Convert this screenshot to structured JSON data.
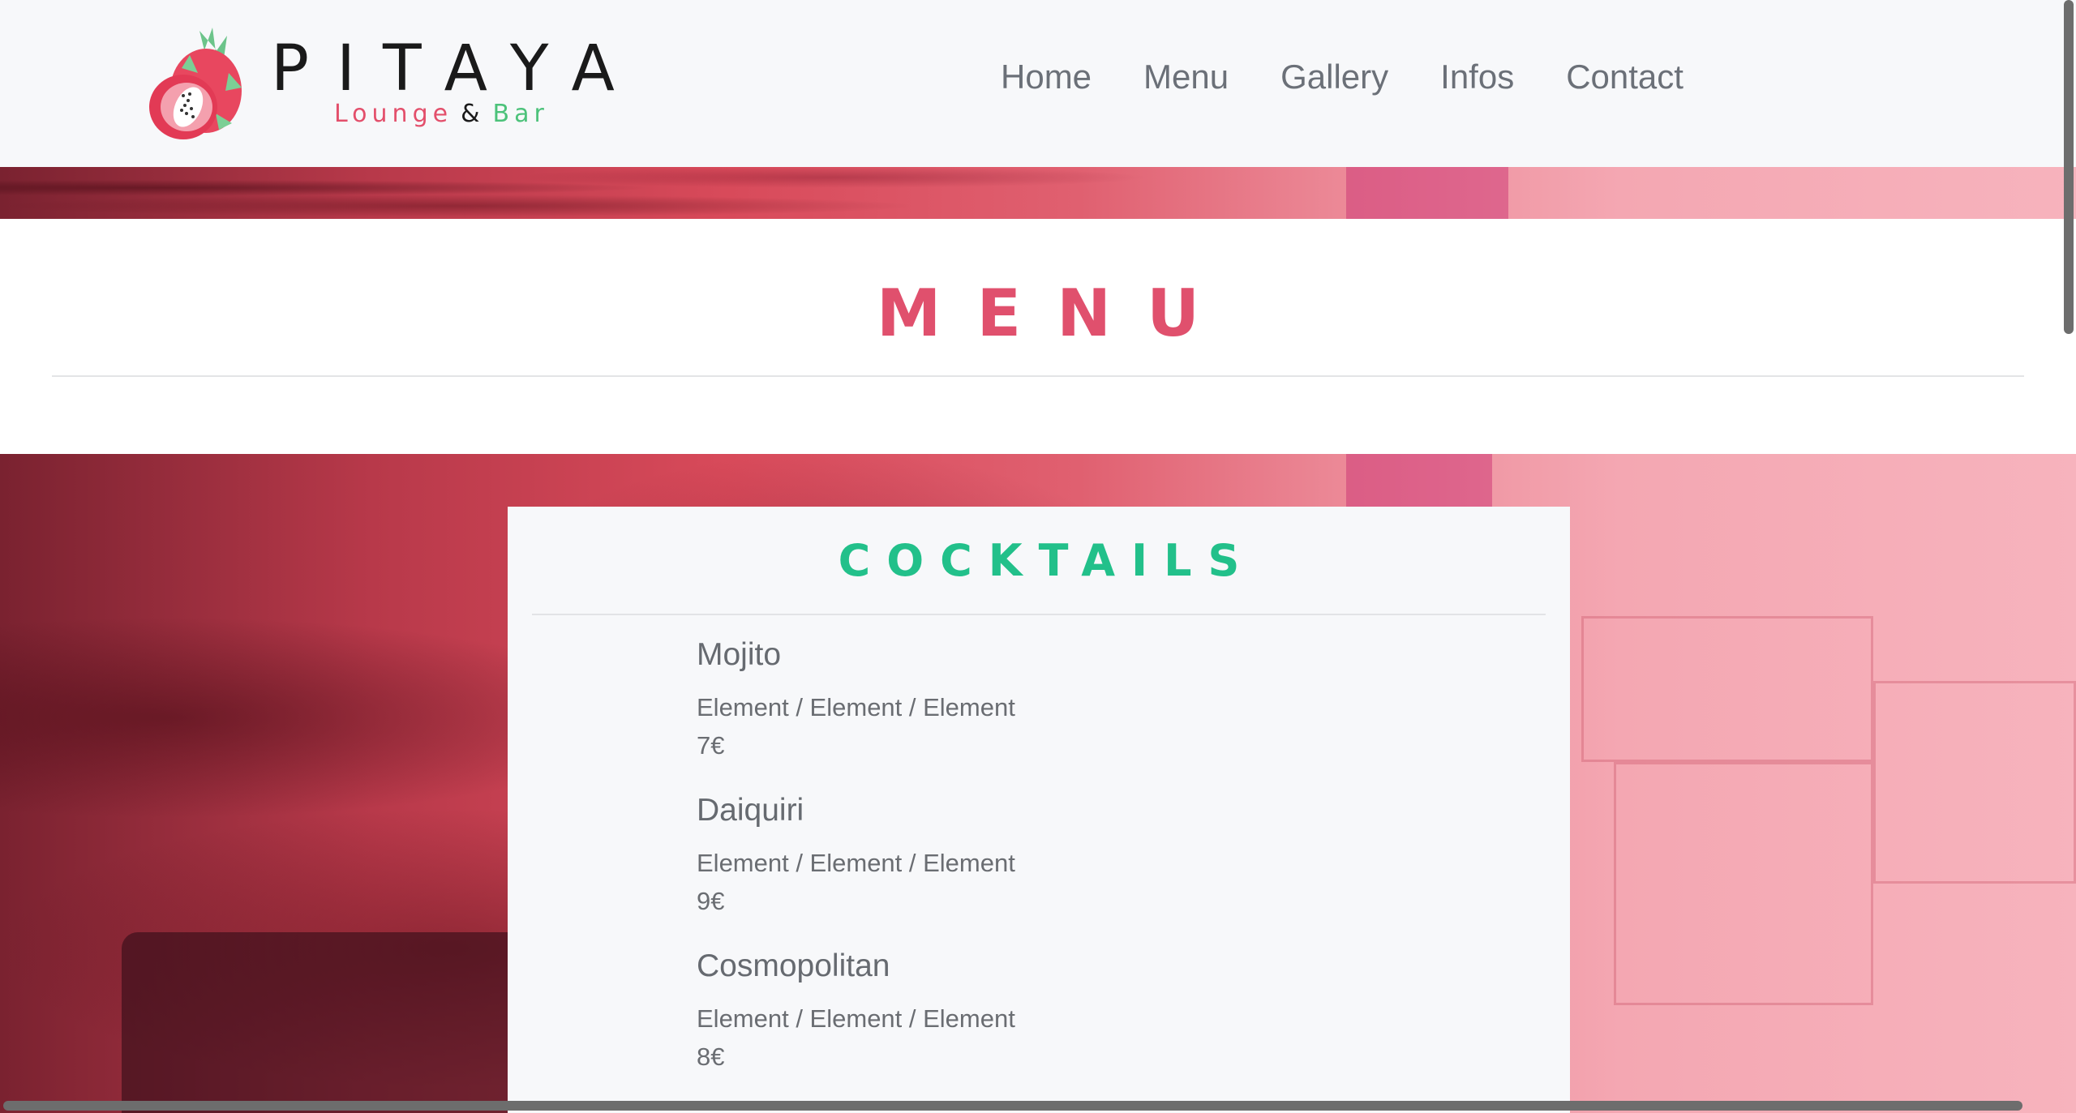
{
  "header": {
    "brand": "PITAYA",
    "tagline": {
      "lounge": "Lounge",
      "amp": "&",
      "bar": "Bar"
    },
    "logo_icon": "dragonfruit-icon",
    "nav": [
      "Home",
      "Menu",
      "Gallery",
      "Infos",
      "Contact"
    ]
  },
  "page": {
    "title": "MENU"
  },
  "section": {
    "title": "COCKTAILS",
    "items": [
      {
        "name": "Mojito",
        "desc": "Element / Element / Element",
        "price": "7€"
      },
      {
        "name": "Daiquiri",
        "desc": "Element / Element / Element",
        "price": "9€"
      },
      {
        "name": "Cosmopolitan",
        "desc": "Element / Element / Element",
        "price": "8€"
      }
    ]
  },
  "colors": {
    "accent_pink": "#e0506d",
    "accent_green": "#22c08a",
    "nav_text": "#6b7078",
    "header_bg": "#f7f8fa"
  }
}
